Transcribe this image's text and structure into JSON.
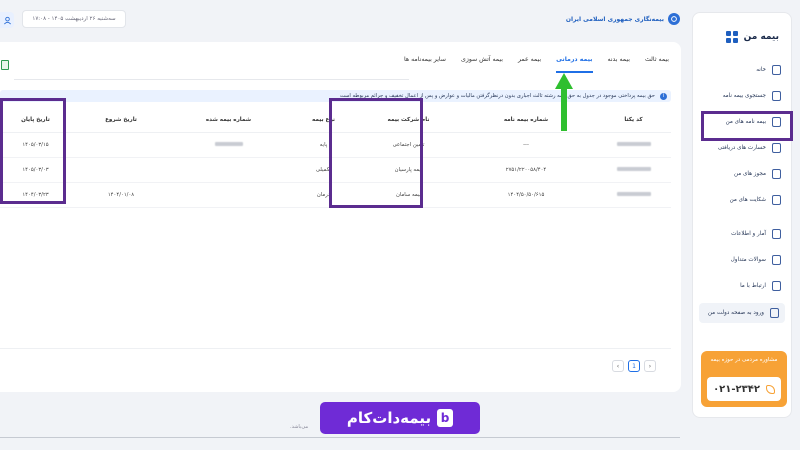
{
  "header": {
    "date_text": "سه‌شنبه ۲۶ اردیبهشت ۱۴۰۵ - ۱۷:۰۸",
    "brand_text": "بیمه‌نگاری جمهوری اسلامی ایران"
  },
  "sidebar": {
    "title": "بیمه من",
    "items": [
      {
        "label": "خانه"
      },
      {
        "label": "جستجوی بیمه نامه"
      },
      {
        "label": "بیمه نامه های من"
      },
      {
        "label": "خسارت های دریافتی"
      },
      {
        "label": "مجوز های من"
      },
      {
        "label": "شکایت های من"
      },
      {
        "label": "آمار و اطلاعات"
      },
      {
        "label": "سوالات متداول"
      },
      {
        "label": "ارتباط با ما"
      },
      {
        "label": "ورود به صفحه دولت من"
      }
    ],
    "hotline_title": "مشاوره مردمی در حوزه بیمه",
    "hotline_number": "۰۲۱-۲۳۴۲"
  },
  "tabs": [
    {
      "label": "بیمه ثالث"
    },
    {
      "label": "بیمه بدنه"
    },
    {
      "label": "بیمه درمانی"
    },
    {
      "label": "بیمه عمر"
    },
    {
      "label": "بیمه آتش سوزی"
    },
    {
      "label": "سایر بیمه‌نامه ها"
    }
  ],
  "active_tab": "بیمه درمانی",
  "info_text": "حق بیمه پرداختی موجود در جدول به حق بیمه رشته ثالث اجباری بدون درنظرگرفتن مالیات و عوارض و پس از اعمال تخفیف و جرائم مربوطه است",
  "table": {
    "columns": [
      "کد یکتا",
      "شماره بیمه نامه",
      "نام شرکت بیمه",
      "نوع بیمه",
      "شماره بیمه شده",
      "تاریخ شروع",
      "تاریخ پایان"
    ],
    "rows": [
      {
        "policy_number": "---",
        "company": "تامین اجتماعی",
        "type": "پایه",
        "start": "",
        "end": "۱۴۰۵/۰۳/۱۵"
      },
      {
        "policy_number": "۲۷۵۱/۲۲۰۰۵۸/۴۰۴",
        "company": "بیمه پارسیان",
        "type": "تکمیلی",
        "start": "",
        "end": "۱۴۰۵/۰۳/۰۳"
      },
      {
        "policy_number": "۱۴۰۴/۵۰/۵۰/۶۱۵",
        "company": "بیمه سامان",
        "type": "درمان",
        "start": "۱۴۰۴/۰۱/۰۸",
        "end": "۱۴۰۴/۰۳/۲۳"
      }
    ]
  },
  "pagination": {
    "current": "1",
    "prev": "‹",
    "next": "›"
  },
  "watermark": {
    "text": "بیمه‌دات‌کام",
    "badge": "b"
  },
  "footer_text": "می‌باشد."
}
